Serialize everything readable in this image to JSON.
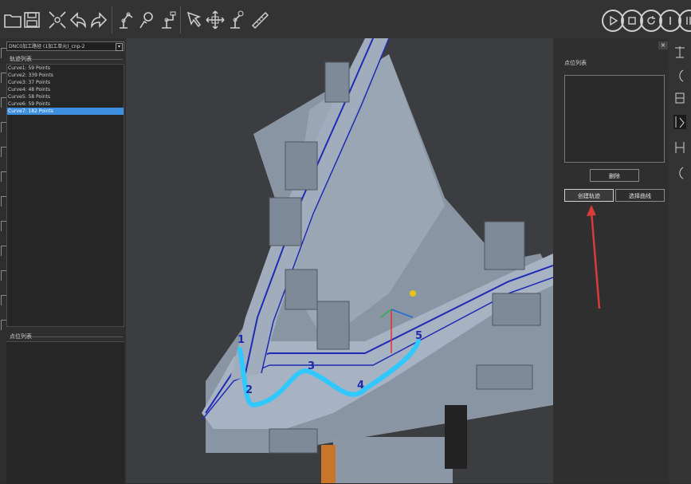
{
  "toolbar": {
    "left_icons": [
      "folder-icon",
      "save-icon",
      "scatter-icon",
      "undo-icon",
      "redo-icon",
      "robot-arm-icon",
      "robot-gear-icon",
      "robot-config-icon",
      "pointer-icon",
      "move-icon",
      "robot-link-icon",
      "ruler-icon"
    ],
    "right_buttons": [
      "play-icon",
      "stop-icon",
      "reset-icon",
      "pause-icon",
      "end-icon"
    ]
  },
  "left_panel": {
    "combo_value": "DNC0加工路径 (1加工单元)_cnp-2",
    "path_list_title": "轨迹列表",
    "paths": [
      "Curve1: 59 Points",
      "Curve2: 339 Points",
      "Curve3: 37 Points",
      "Curve4: 48 Points",
      "Curve5: 58 Points",
      "Curve6: 59 Points",
      "Curve7: 182 Points"
    ],
    "selected_index": 6,
    "point_list_title": "点位列表"
  },
  "viewport": {
    "point_labels": [
      "1",
      "2",
      "3",
      "4",
      "5"
    ]
  },
  "right_panel": {
    "close_label": "×",
    "section_label": "点位列表",
    "delete_button": "删除",
    "create_button": "创建轨迹",
    "select_button": "选择曲线",
    "highlight_color": "#d93a3a"
  },
  "right_tools": [
    "tool-1-icon",
    "tool-2-icon",
    "tool-3-icon",
    "tool-4-icon",
    "tool-5-icon",
    "tool-6-icon"
  ]
}
